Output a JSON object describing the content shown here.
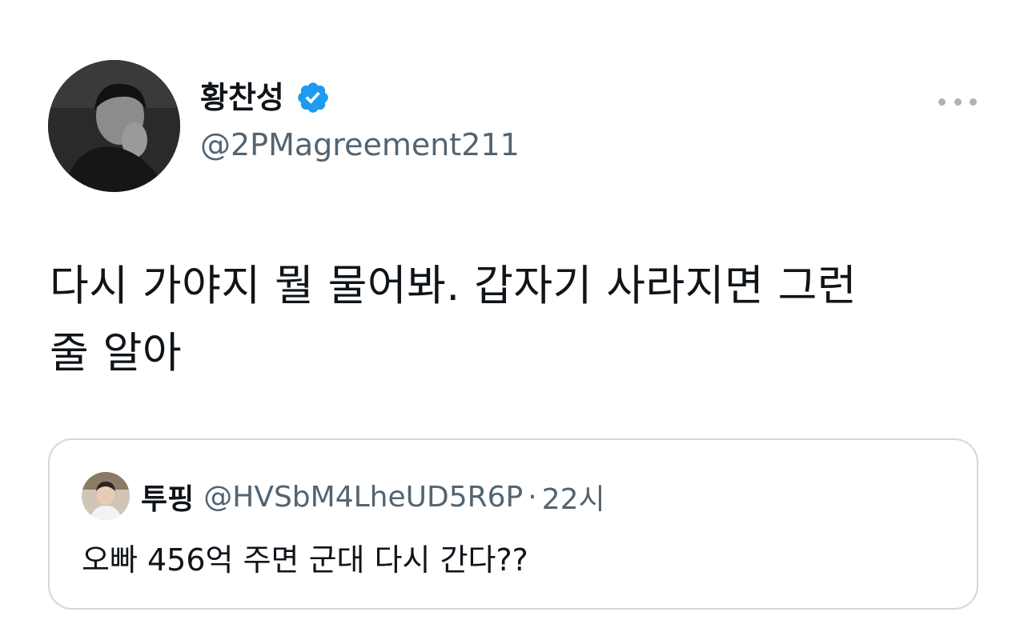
{
  "author": {
    "display_name": "황찬성",
    "handle": "@2PMagreement211",
    "verified": true,
    "avatar": "profile-photo-bw"
  },
  "tweet": {
    "text": "다시 가야지 뭘 물어봐. 갑자기 사라지면 그런\n줄 알아"
  },
  "quoted_tweet": {
    "display_name": "투핑",
    "handle": "@HVSbM4LheUD5R6P",
    "separator": "·",
    "time": "22시",
    "text": "오빠 456억 주면 군대 다시 간다??",
    "avatar": "profile-photo-color"
  },
  "icons": {
    "verified": "verified-badge-icon",
    "more": "more-horizontal-icon"
  },
  "colors": {
    "verified_blue": "#1d9bf0",
    "secondary_text": "#536471",
    "border": "#cfd9de",
    "more_dots": "#a9b4bd"
  }
}
